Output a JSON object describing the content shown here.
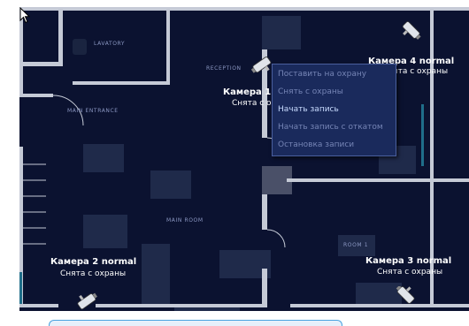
{
  "rooms": {
    "lavatory": "LAVATORY",
    "reception": "RECEPTION",
    "main_entrance": "MAIN ENTRANCE",
    "main_room": "MAIN ROOM",
    "room1": "ROOM 1"
  },
  "cameras": {
    "cam1": {
      "title": "Камера 1",
      "status": "Снята с о"
    },
    "cam2": {
      "title": "Камера 2 normal",
      "status": "Снята с охраны"
    },
    "cam3": {
      "title": "Камера 3 normal",
      "status": "Снята с охраны"
    },
    "cam4": {
      "title": "Камера 4 normal",
      "status": "Снята с охраны"
    }
  },
  "context_menu": {
    "items": [
      {
        "label": "Поставить на охрану",
        "enabled": false
      },
      {
        "label": "Снять с охраны",
        "enabled": false
      },
      {
        "label": "Начать запись",
        "enabled": true
      },
      {
        "label": "Начать запись с откатом",
        "enabled": false
      },
      {
        "label": "Остановка записи",
        "enabled": false
      }
    ]
  },
  "colors": {
    "plan_bg": "#0b1230",
    "wall": "#c5cad6",
    "furniture": "#1f2a4a",
    "menu_bg": "#1a2a5c",
    "menu_text_disabled": "#7584b5",
    "menu_text_active": "#c9dcff",
    "accent_teal": "#1f6e8a"
  }
}
